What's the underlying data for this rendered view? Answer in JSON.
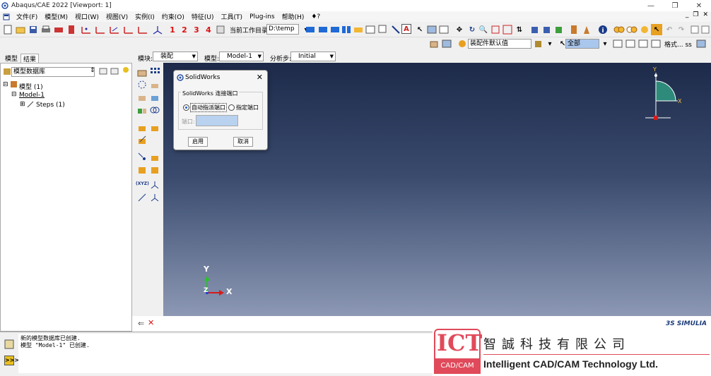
{
  "window": {
    "title": "Abaqus/CAE 2022 [Viewport: 1]"
  },
  "menubar": {
    "items": [
      "文件(F)",
      "模型(M)",
      "视口(W)",
      "视图(V)",
      "实例(I)",
      "约束(O)",
      "特征(U)",
      "工具(T)",
      "Plug-ins",
      "帮助(H)",
      "♦?"
    ]
  },
  "toolbar": {
    "numbers": [
      "1",
      "2",
      "3",
      "4"
    ],
    "work_dir_label": "当前工作目录:",
    "work_dir_value": "D:\\temp"
  },
  "toolbar2": {
    "assembly_defaults": "装配件默认值",
    "selection": "全部",
    "caption": "格式... ss"
  },
  "panel_tabs": [
    "模型",
    "结果"
  ],
  "context": {
    "module_label": "模块:",
    "module_value": "装配",
    "model_label": "模型:",
    "model_value": "Model-1",
    "step_label": "分析步:",
    "step_value": "Initial"
  },
  "tree": {
    "database": "模型数据库",
    "root": "模型 (1)",
    "model": "Model-1",
    "steps": "Steps (1)"
  },
  "dialog": {
    "title": "SolidWorks",
    "group_label": "SolidWorks 连接端口",
    "auto_port": "自动指派端口",
    "specified_port": "指定端口",
    "port_label": "端口:",
    "apply": "启用",
    "cancel": "取消"
  },
  "viewport": {
    "axis_y": "Y",
    "axis_x": "X",
    "axis_z": "Z",
    "triad_y": "Y",
    "triad_x": "X",
    "brand": "3S SIMULIA"
  },
  "messages": [
    "新的模型数据库已创建.",
    "模型 \"Model-1\" 已创建."
  ],
  "logo": {
    "ict": "ICT",
    "cadcam": "CAD/CAM",
    "chinese": "智誠科技有限公司",
    "english": "Intelligent CAD/CAM Technology Ltd."
  }
}
